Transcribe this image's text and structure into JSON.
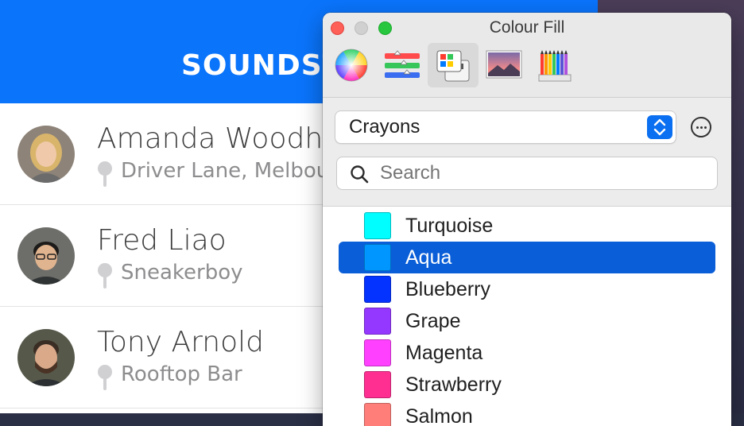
{
  "app": {
    "title": "SOUNDSTA",
    "contacts": [
      {
        "name": "Amanda Woodho",
        "location": "Driver Lane, Melbou"
      },
      {
        "name": "Fred Liao",
        "location": "Sneakerboy"
      },
      {
        "name": "Tony Arnold",
        "location": "Rooftop Bar"
      }
    ]
  },
  "panel": {
    "title": "Colour Fill",
    "tools": [
      "colour-wheel",
      "colour-sliders",
      "colour-palettes",
      "image-palettes",
      "pencils"
    ],
    "selected_tool": "colour-palettes",
    "palette_select": {
      "value": "Crayons"
    },
    "search": {
      "placeholder": "Search",
      "value": ""
    },
    "crayons": [
      {
        "name": "Turquoise",
        "color": "#00fdff",
        "selected": false
      },
      {
        "name": "Aqua",
        "color": "#0096ff",
        "selected": true
      },
      {
        "name": "Blueberry",
        "color": "#0433ff",
        "selected": false
      },
      {
        "name": "Grape",
        "color": "#9437ff",
        "selected": false
      },
      {
        "name": "Magenta",
        "color": "#ff40ff",
        "selected": false
      },
      {
        "name": "Strawberry",
        "color": "#ff2f92",
        "selected": false
      },
      {
        "name": "Salmon",
        "color": "#ff7e79",
        "selected": false
      }
    ]
  },
  "colors": {
    "app_header": "#0a74fb",
    "selection": "#0a5ed8"
  }
}
